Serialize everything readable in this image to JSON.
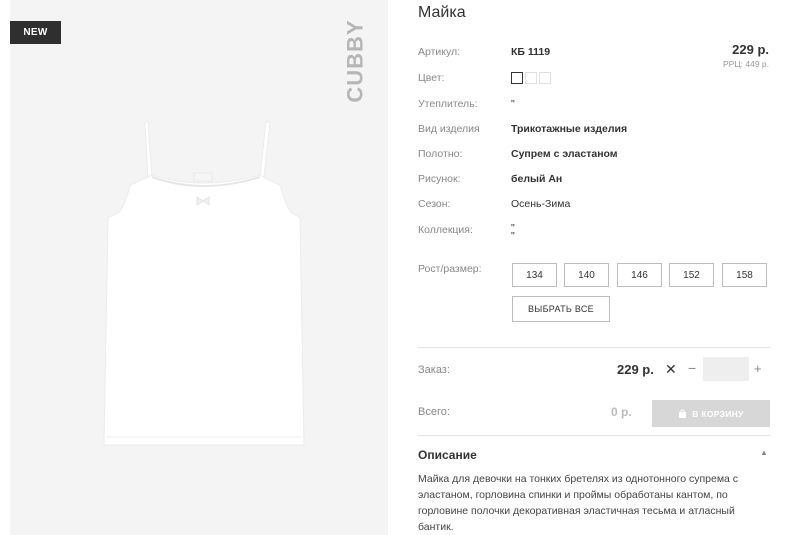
{
  "product": {
    "badge": "NEW",
    "brand": "CUBBY",
    "title": "Майка",
    "price": "229 р.",
    "rrp": "РРЦ: 449 р."
  },
  "attributes": {
    "article_label": "Артикул:",
    "article_value": "КБ 1119",
    "color_label": "Цвет:",
    "insulation_label": "Утеплитель:",
    "insulation_value": "\"",
    "type_label": "Вид изделия",
    "type_value": "Трикотажные изделия",
    "fabric_label": "Полотно:",
    "fabric_value": "Супрем с эластаном",
    "pattern_label": "Рисунок:",
    "pattern_value": "белый Ан",
    "season_label": "Сезон:",
    "season_value": "Осень-Зима",
    "collection_label": "Коллекция:",
    "collection_value_1": "\"",
    "collection_value_2": "\""
  },
  "sizes": {
    "label": "Рост/размер:",
    "options": [
      "134",
      "140",
      "146",
      "152",
      "158"
    ],
    "select_all": "ВЫБРАТЬ ВСЕ"
  },
  "order": {
    "label": "Заказ:",
    "price": "229 р.",
    "clear": "✕",
    "minus": "−",
    "plus": "+",
    "quantity": "",
    "total_label": "Всего:",
    "total_value": "0 р.",
    "cart_button": "В КОРЗИНУ"
  },
  "description": {
    "header": "Описание",
    "collapse": "▲",
    "text": "Майка для девочки на тонких бретелях из однотонного супрема с эластаном, горловина спинки и проймы обработаны кантом, по горловине полочки декоративная эластичная тесьма и атласный бантик."
  },
  "icons": {
    "bag": "shopping-bag-icon"
  },
  "colors": {
    "badge_bg": "#2f2f2f",
    "image_bg": "#f4f4f4",
    "cart_button_bg": "#d7d7d7",
    "brand_text": "#b6b6b6"
  }
}
